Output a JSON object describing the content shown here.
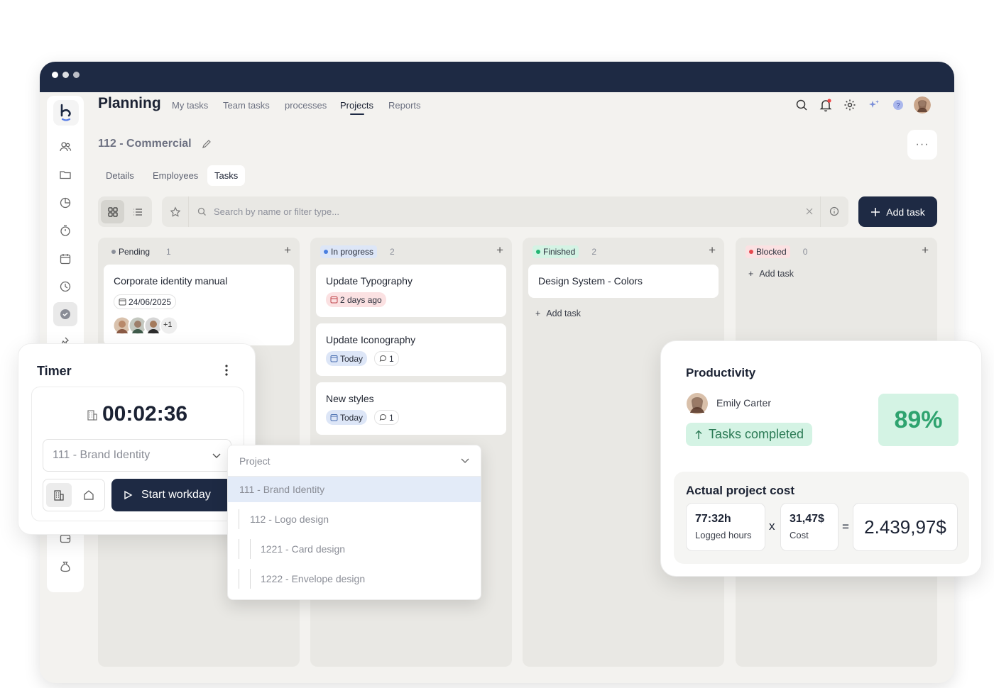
{
  "app": {
    "title": "Planning",
    "nav": [
      "My tasks",
      "Team tasks",
      "processes",
      "Projects",
      "Reports"
    ],
    "active_nav": "Projects",
    "icons": [
      "search-icon",
      "bell-icon",
      "gear-icon",
      "sparkle-icon",
      "help-icon",
      "user-avatar"
    ],
    "notification_color": "#ef4444"
  },
  "project": {
    "title": "112 - Commercial",
    "tabs": [
      "Details",
      "Employees",
      "Tasks"
    ],
    "active_tab": "Tasks"
  },
  "toolbar": {
    "search_placeholder": "Search by name or filter type...",
    "add_task_label": "Add task"
  },
  "board": {
    "columns": [
      {
        "name": "Pending",
        "count": "1",
        "dot_color": "#8b8f99",
        "pill_bg": "#e9e8e4",
        "cards": [
          {
            "title": "Corporate identity manual",
            "date": "24/06/2025",
            "extra_assignees": "+1"
          }
        ]
      },
      {
        "name": "In progress",
        "count": "2",
        "dot_color": "#4a7fe0",
        "pill_bg": "#dde6f7",
        "cards": [
          {
            "title": "Update Typography",
            "due": "2 days ago"
          },
          {
            "title": "Update Iconography",
            "due": "Today",
            "comments": "1"
          },
          {
            "title": "New styles",
            "due": "Today",
            "comments": "1"
          }
        ]
      },
      {
        "name": "Finished",
        "count": "2",
        "dot_color": "#22b573",
        "pill_bg": "#d4f3e4",
        "cards": [
          {
            "title": "Design System - Colors"
          }
        ],
        "add_label": "Add task"
      },
      {
        "name": "Blocked",
        "count": "0",
        "dot_color": "#e5484d",
        "pill_bg": "#fbe1e2",
        "cards": [],
        "add_label": "Add task"
      }
    ]
  },
  "timer": {
    "title": "Timer",
    "time": "00:02:36",
    "project": "111 - Brand Identity",
    "start_label": "Start workday"
  },
  "project_dropdown": {
    "placeholder": "Project",
    "items": [
      {
        "label": "111 - Brand Identity",
        "level": 0,
        "selected": true
      },
      {
        "label": "112 - Logo design",
        "level": 1
      },
      {
        "label": "1221 - Card design",
        "level": 2
      },
      {
        "label": "1222 - Envelope design",
        "level": 2
      }
    ]
  },
  "productivity": {
    "title": "Productivity",
    "person": "Emily Carter",
    "badge": "Tasks completed",
    "percent": "89%"
  },
  "cost": {
    "title": "Actual project cost",
    "hours": "77:32h",
    "hours_label": "Logged hours",
    "rate": "31,47$",
    "rate_label": "Cost",
    "total": "2.439,97$",
    "times": "x",
    "equals": "="
  }
}
